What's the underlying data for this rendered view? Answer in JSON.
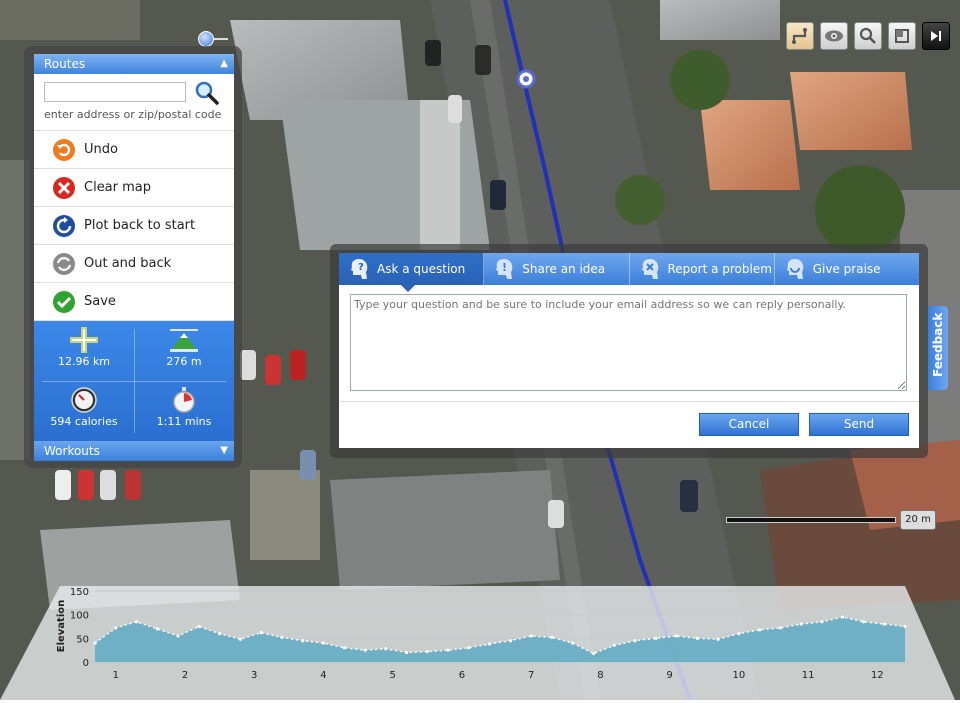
{
  "map": {
    "tools": [
      {
        "name": "route-tool-icon",
        "active": true
      },
      {
        "name": "eye-icon",
        "active": false
      },
      {
        "name": "search-icon",
        "active": false
      },
      {
        "name": "window-icon",
        "active": false
      },
      {
        "name": "collapse-icon",
        "active": false,
        "dark": true
      }
    ],
    "scale": "20 m"
  },
  "routes": {
    "title": "Routes",
    "search_placeholder": "",
    "search_hint": "enter address or zip/postal code",
    "actions": [
      {
        "label": "Undo",
        "icon": "undo-icon",
        "color": "#f07b1e"
      },
      {
        "label": "Clear map",
        "icon": "clear-map-icon",
        "color": "#d9261f"
      },
      {
        "label": "Plot back to start",
        "icon": "plot-back-icon",
        "color": "#1f4d9c"
      },
      {
        "label": "Out and back",
        "icon": "out-and-back-icon",
        "color": "#8a8a8a"
      },
      {
        "label": "Save",
        "icon": "save-icon",
        "color": "#2fa32f"
      }
    ],
    "stats": {
      "distance": "12.96 km",
      "elevation": "276 m",
      "calories": "594 calories",
      "time": "1:11 mins"
    },
    "workouts": "Workouts"
  },
  "feedback": {
    "tabs": [
      {
        "label": "Ask a question",
        "active": true
      },
      {
        "label": "Share an idea",
        "active": false
      },
      {
        "label": "Report a problem",
        "active": false
      },
      {
        "label": "Give praise",
        "active": false
      }
    ],
    "placeholder": "Type your question and be sure to include your email address so we can reply personally.",
    "cancel": "Cancel",
    "send": "Send",
    "side_tab": "Feedback"
  },
  "chart_data": {
    "type": "area",
    "title": "",
    "ylabel": "Elevation",
    "xlabel": "",
    "ylim": [
      0,
      150
    ],
    "yticks": [
      0,
      50,
      100,
      150
    ],
    "xlim": [
      0.7,
      12.4
    ],
    "xticks": [
      1,
      2,
      3,
      4,
      5,
      6,
      7,
      8,
      9,
      10,
      11,
      12
    ],
    "x": [
      0.7,
      1.0,
      1.3,
      1.6,
      1.9,
      2.2,
      2.5,
      2.8,
      3.1,
      3.4,
      3.7,
      4.0,
      4.3,
      4.6,
      4.9,
      5.2,
      5.5,
      5.8,
      6.1,
      6.4,
      6.7,
      7.0,
      7.3,
      7.6,
      7.9,
      8.2,
      8.5,
      8.8,
      9.1,
      9.4,
      9.7,
      10.0,
      10.3,
      10.6,
      10.9,
      11.2,
      11.5,
      11.8,
      12.1,
      12.4
    ],
    "y": [
      40,
      72,
      85,
      70,
      55,
      75,
      60,
      48,
      62,
      52,
      45,
      40,
      30,
      25,
      28,
      20,
      22,
      25,
      30,
      38,
      45,
      55,
      52,
      40,
      18,
      35,
      45,
      50,
      55,
      50,
      48,
      60,
      68,
      72,
      80,
      85,
      95,
      85,
      80,
      75
    ]
  }
}
